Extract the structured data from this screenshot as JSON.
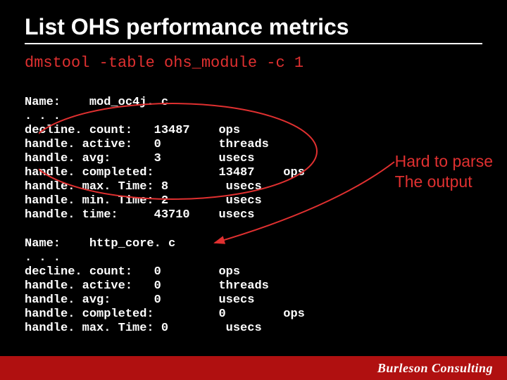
{
  "title": "List OHS performance metrics",
  "command": "dmstool -table ohs_module -c 1",
  "block1": {
    "name_line": "Name:    mod_oc4j. c",
    "ellipsis": ". . .",
    "rows": [
      "decline. count:   13487    ops",
      "handle. active:   0        threads",
      "handle. avg:      3        usecs",
      "handle. completed:         13487    ops",
      "handle. max. Time: 8        usecs",
      "handle. min. Time: 2        usecs",
      "handle. time:     43710    usecs"
    ]
  },
  "block2": {
    "name_line": "Name:    http_core. c",
    "ellipsis": ". . .",
    "rows": [
      "decline. count:   0        ops",
      "handle. active:   0        threads",
      "handle. avg:      0        usecs",
      "handle. completed:         0        ops",
      "handle. max. Time: 0        usecs"
    ]
  },
  "annotation": {
    "line1": "Hard to parse",
    "line2": "The output"
  },
  "footer": "Burleson Consulting"
}
